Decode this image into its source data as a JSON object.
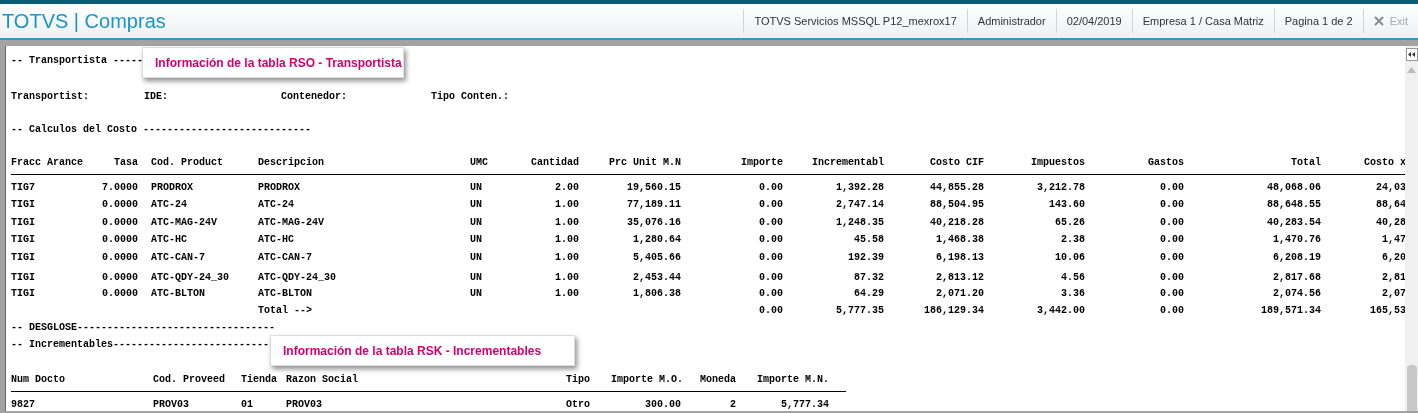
{
  "header": {
    "app_title": "TOTVS | Compras",
    "status_items": [
      "TOTVS Servicios MSSQL P12_mexrox17",
      "Administrador",
      "02/04/2019",
      "Empresa 1 / Casa Matriz",
      "Pagina 1 de 2"
    ],
    "exit": {
      "label": "Exit",
      "disabled": true
    }
  },
  "report": {
    "transportista_heading": "-- Transportista -----",
    "transportista_fields": [
      "Transportist:",
      "IDE:",
      "Contenedor:",
      "Tipo Conten.:"
    ],
    "costos_heading": "-- Calculos del Costo ----------------------------",
    "costos_table": {
      "columns": [
        "Fracc Arance",
        "Tasa",
        "Cod. Product",
        "Descripcion",
        "UMC",
        "Cantidad",
        "Prc Unit M.N",
        "Importe",
        "Incrementabl",
        "Costo CIF",
        "Impuestos",
        "Gastos",
        "Total",
        "Costo x"
      ],
      "rows": [
        [
          "TIG7",
          "7.0000",
          "PRODROX",
          "PRODROX",
          "UN",
          "2.00",
          "19,560.15",
          "0.00",
          "1,392.28",
          "44,855.28",
          "3,212.78",
          "0.00",
          "48,068.06",
          "24,03"
        ],
        [
          "TIGI",
          "0.0000",
          "ATC-24",
          "ATC-24",
          "UN",
          "1.00",
          "77,189.11",
          "0.00",
          "2,747.14",
          "88,504.95",
          "143.60",
          "0.00",
          "88,648.55",
          "88,64"
        ],
        [
          "TIGI",
          "0.0000",
          "ATC-MAG-24V",
          "ATC-MAG-24V",
          "UN",
          "1.00",
          "35,076.16",
          "0.00",
          "1,248.35",
          "40,218.28",
          "65.26",
          "0.00",
          "40,283.54",
          "40,28"
        ],
        [
          "TIGI",
          "0.0000",
          "ATC-HC",
          "ATC-HC",
          "UN",
          "1.00",
          "1,280.64",
          "0.00",
          "45.58",
          "1,468.38",
          "2.38",
          "0.00",
          "1,470.76",
          "1,47"
        ],
        [
          "TIGI",
          "0.0000",
          "ATC-CAN-7",
          "ATC-CAN-7",
          "UN",
          "1.00",
          "5,405.66",
          "0.00",
          "192.39",
          "6,198.13",
          "10.06",
          "0.00",
          "6,208.19",
          "6,20"
        ],
        [
          "TIGI",
          "0.0000",
          "ATC-QDY-24_30",
          "ATC-QDY-24_30",
          "UN",
          "1.00",
          "2,453.44",
          "0.00",
          "87.32",
          "2,813.12",
          "4.56",
          "0.00",
          "2,817.68",
          "2,81"
        ],
        [
          "TIGI",
          "0.0000",
          "ATC-BLTON",
          "ATC-BLTON",
          "UN",
          "1.00",
          "1,806.38",
          "0.00",
          "64.29",
          "2,071.20",
          "3.36",
          "0.00",
          "2,074.56",
          "2,07"
        ]
      ],
      "total": {
        "label": "Total -->",
        "values": [
          "0.00",
          "5,777.35",
          "186,129.34",
          "3,442.00",
          "0.00",
          "189,571.34",
          "165,53"
        ]
      }
    },
    "desglose_heading": "-- DESGLOSE---------------------------------",
    "incrementables_heading": "-- Incrementables--------------------------",
    "incrementables_table": {
      "columns": [
        "Num Docto",
        "Cod. Proveed",
        "Tienda",
        "Razon Social",
        "Tipo",
        "Importe M.O.",
        "Moneda",
        "Importe M.N."
      ],
      "rows": [
        [
          "9827",
          "PROV03",
          "01",
          "PROV03",
          "Otro",
          "300.00",
          "2",
          "5,777.34"
        ]
      ]
    }
  },
  "callouts": [
    {
      "text": "Información de la tabla RSO - Transportista"
    },
    {
      "text": "Información de la tabla RSK - Incrementables"
    }
  ]
}
